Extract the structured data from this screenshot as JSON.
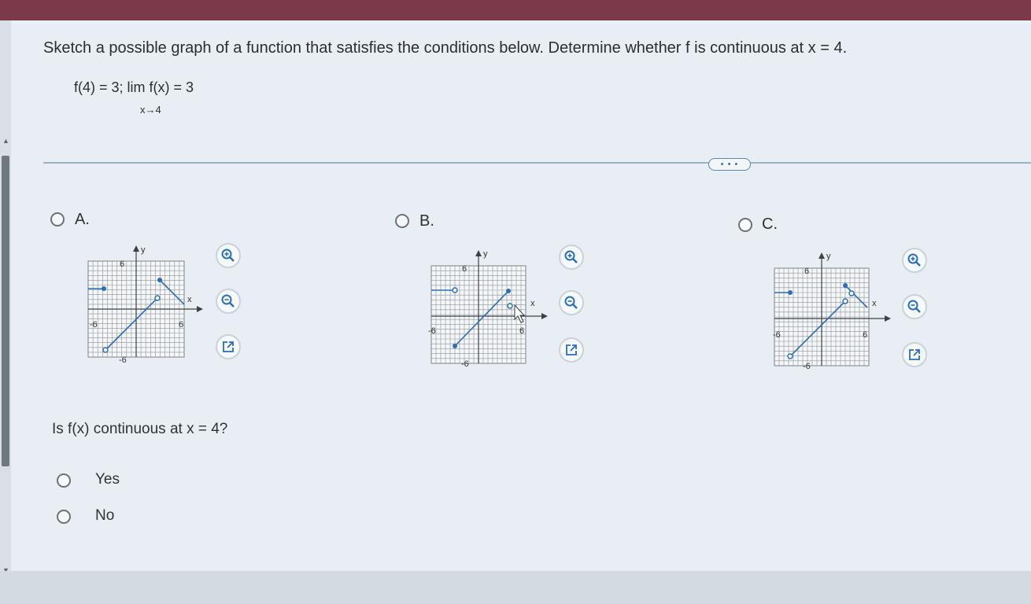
{
  "question": {
    "text": "Sketch a possible graph of a function that satisfies the conditions below. Determine whether f is continuous at x = 4.",
    "conditions": "f(4) = 3;  lim  f(x) = 3",
    "limit_subscript": "x→4"
  },
  "more_button": "• • •",
  "options": [
    {
      "letter": "A.",
      "y_label": "y",
      "x_label": "x",
      "ticks": {
        "y_pos": "6",
        "x_neg": "-6",
        "x_pos": "6",
        "y_neg": "-6"
      }
    },
    {
      "letter": "B.",
      "y_label": "y",
      "x_label": "x",
      "ticks": {
        "y_pos": "6",
        "x_neg": "-6",
        "x_pos": "6",
        "y_neg": "-6"
      }
    },
    {
      "letter": "C.",
      "y_label": "y",
      "x_label": "x",
      "ticks": {
        "y_pos": "6",
        "x_neg": "-6",
        "x_pos": "6",
        "y_neg": "-6"
      }
    }
  ],
  "tools": [
    "zoom-in-icon",
    "zoom-out-icon",
    "external-link-icon"
  ],
  "sub_question": "Is f(x) continuous at x = 4?",
  "answers": [
    "Yes",
    "No"
  ],
  "colors": {
    "accent": "#2a6fba",
    "header": "#7a3a4a"
  }
}
